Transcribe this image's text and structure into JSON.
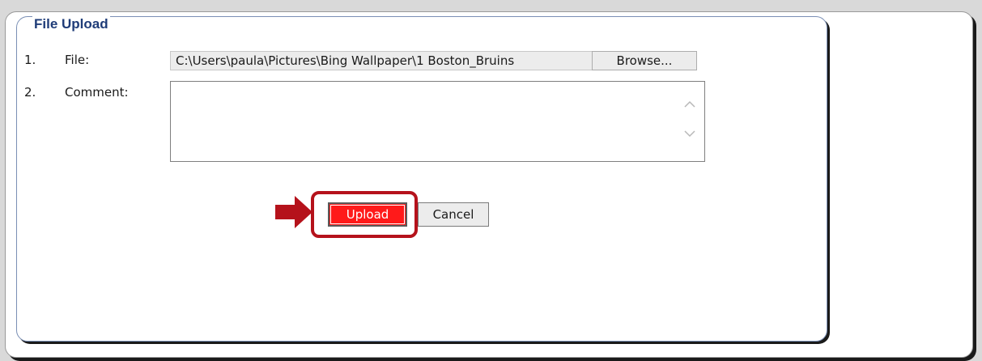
{
  "form": {
    "legend": "File Upload",
    "rows": [
      {
        "number": "1.",
        "label": "File:"
      },
      {
        "number": "2.",
        "label": "Comment:"
      }
    ],
    "file_value": "C:\\Users\\paula\\Pictures\\Bing Wallpaper\\1 Boston_Bruins",
    "browse_label": "Browse...",
    "comment_value": "",
    "upload_label": "Upload",
    "cancel_label": "Cancel"
  },
  "colors": {
    "legend_text": "#1f3c78",
    "highlight": "#b5121b",
    "upload_button": "#ff1a1a"
  },
  "icons": {
    "scroll_up": "chevron-up-icon",
    "scroll_down": "chevron-down-icon",
    "annotation": "right-arrow-icon"
  }
}
